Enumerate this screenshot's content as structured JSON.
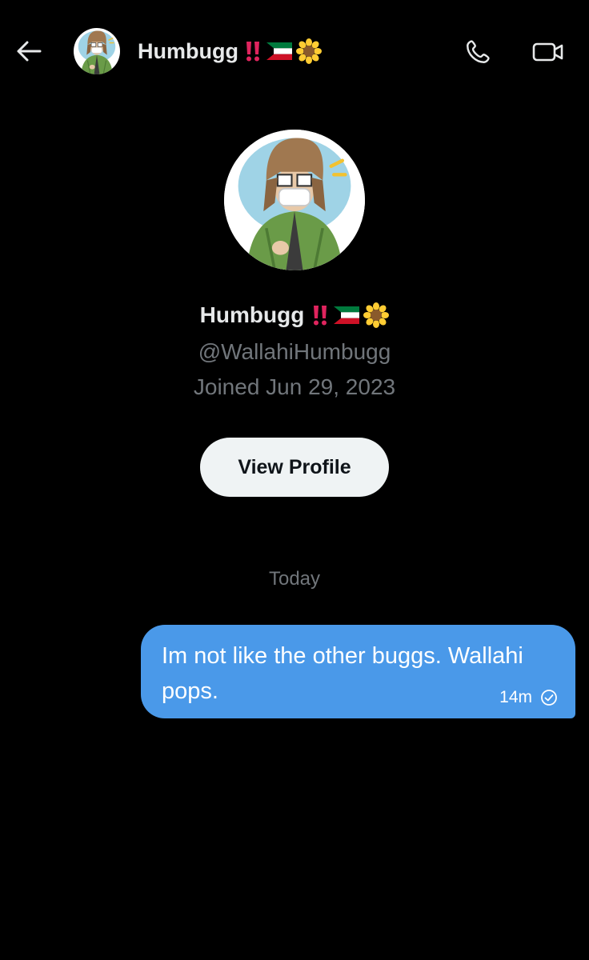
{
  "header": {
    "back_label": "Back",
    "name": "Humbugg",
    "emojis": [
      "double-exclamation",
      "kuwait-flag",
      "sunflower"
    ],
    "call_icon": "phone-icon",
    "video_icon": "video-camera-icon"
  },
  "profile": {
    "name": "Humbugg",
    "emojis": [
      "double-exclamation",
      "kuwait-flag",
      "sunflower"
    ],
    "handle": "@WallahiHumbugg",
    "joined": "Joined Jun 29, 2023",
    "view_profile_label": "View Profile"
  },
  "conversation": {
    "date_divider": "Today",
    "messages": [
      {
        "text": "Im not like the other buggs. Wallahi pops.",
        "time": "14m",
        "status_icon": "sent-check-icon",
        "direction": "outgoing"
      }
    ]
  },
  "colors": {
    "background": "#000000",
    "bubble": "#4a99e9",
    "muted_text": "#71767b",
    "primary_text": "#e7e9ea",
    "button_bg": "#eff3f4"
  }
}
